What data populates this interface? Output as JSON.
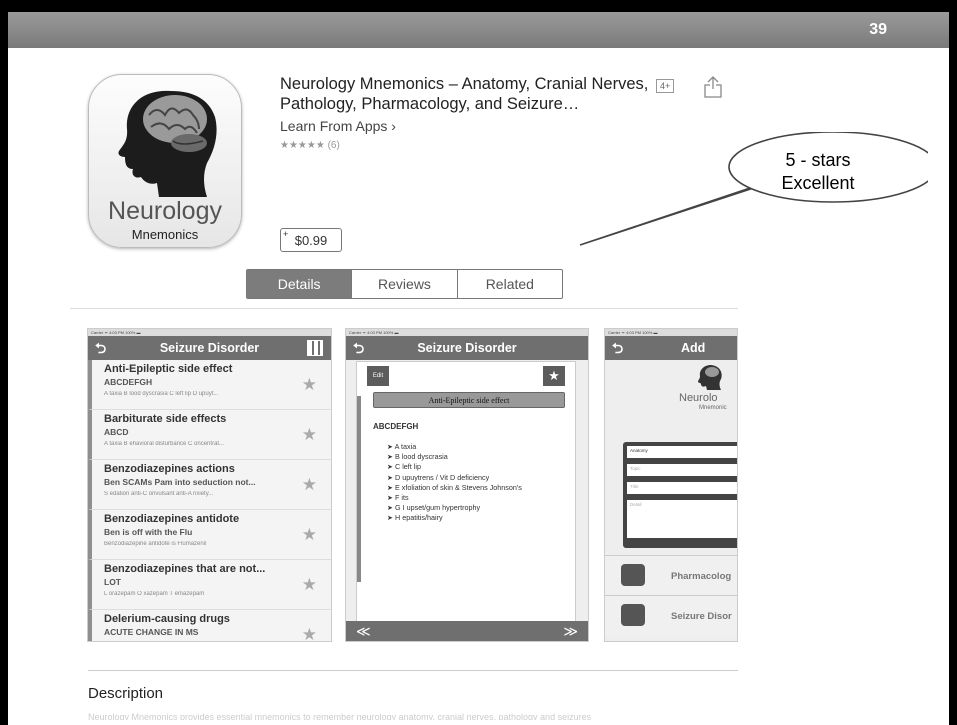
{
  "slide": {
    "page_number": "39"
  },
  "app": {
    "icon_title": "Neurology",
    "icon_subtitle": "Mnemonics",
    "title": "Neurology Mnemonics – Anatomy, Cranial Nerves, Pathology, Pharmacology, and Seizure…",
    "developer": "Learn From Apps",
    "rating_text": "★★★★★ (6)",
    "age_rating": "4+",
    "price": "$0.99"
  },
  "callout": {
    "line1": "5 - stars",
    "line2": "Excellent"
  },
  "tabs": [
    "Details",
    "Reviews",
    "Related"
  ],
  "description": {
    "heading": "Description",
    "preview": "Neurology Mnemonics provides essential mnemonics to remember neurology anatomy, cranial nerves, pathology and seizures"
  },
  "screenshot1": {
    "status": "Carrier ᯤ          4:03 PM          100% ▬",
    "nav_title": "Seizure Disorder",
    "rows": [
      {
        "title": "Anti-Epileptic side effect",
        "sub": "ABCDEFGH",
        "detail": "A taxia   B lood dyscrasia   C left lip   D upuyt..."
      },
      {
        "title": "Barbiturate side effects",
        "sub": "ABCD",
        "detail": "A taxia   B ehavioral disturbance   C oncentrat..."
      },
      {
        "title": "Benzodiazepines actions",
        "sub": "Ben SCAMs Pam into seduction not...",
        "detail": "S edation   anti-C onvulsant   anti-A nxiety..."
      },
      {
        "title": "Benzodiazepines antidote",
        "sub": "Ben is off with the Flu",
        "detail": "Benzodiazepine antidote is Flumazenil"
      },
      {
        "title": "Benzodiazepines that are not...",
        "sub": "LOT",
        "detail": "L orazepam   O xazepam   T emazepam"
      },
      {
        "title": "Delerium-causing drugs",
        "sub": "ACUTE CHANGE IN MS",
        "detail": ""
      }
    ]
  },
  "screenshot2": {
    "nav_title": "Seizure Disorder",
    "edit_label": "Edit",
    "heading": "Anti-Epileptic side effect",
    "mnemonic": "ABCDEFGH",
    "items": [
      "➤ A taxia",
      "➤ B lood dyscrasia",
      "➤ C left lip",
      "➤ D upuytrens / Vit D deficiency",
      "➤ E xfoliation of skin & Stevens Johnson's",
      "➤ F its",
      "➤ G I upset/gum hypertrophy",
      "➤ H epatitis/hairy"
    ],
    "prev": "≪",
    "next": "≫"
  },
  "screenshot3": {
    "nav_title": "Add Mnem",
    "brand": "Neurolo",
    "brand_sub": "Mnemonic",
    "fields": [
      "Anatomy",
      "Topic",
      "Title",
      "Detail"
    ],
    "rows": [
      "Pharmacolog",
      "Seizure Disor"
    ]
  }
}
